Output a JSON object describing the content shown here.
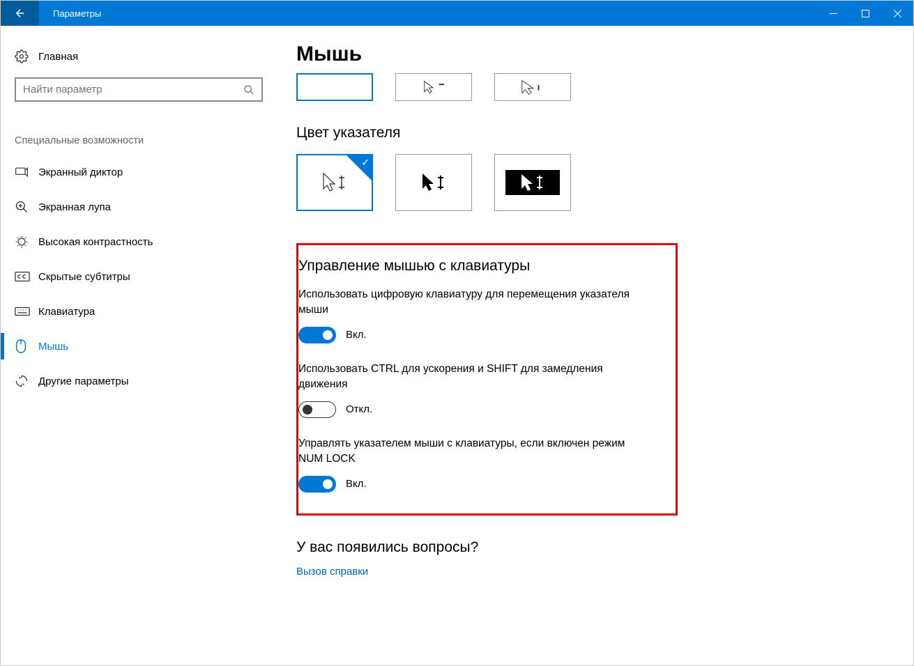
{
  "titlebar": {
    "title": "Параметры"
  },
  "sidebar": {
    "home": "Главная",
    "search_placeholder": "Найти параметр",
    "section": "Специальные возможности",
    "items": [
      {
        "label": "Экранный диктор"
      },
      {
        "label": "Экранная лупа"
      },
      {
        "label": "Высокая контрастность"
      },
      {
        "label": "Скрытые субтитры"
      },
      {
        "label": "Клавиатура"
      },
      {
        "label": "Мышь"
      },
      {
        "label": "Другие параметры"
      }
    ]
  },
  "main": {
    "title": "Мышь",
    "pointer_color_heading": "Цвет указателя",
    "keyboard_control": {
      "heading": "Управление мышью с клавиатуры",
      "numpad_label": "Использовать цифровую клавиатуру для перемещения указателя мыши",
      "numpad_state": "Вкл.",
      "ctrlshift_label": "Использовать CTRL для ускорения и SHIFT для замедления движения",
      "ctrlshift_state": "Откл.",
      "numlock_label": "Управлять указателем мыши с клавиатуры, если включен режим NUM LOCK",
      "numlock_state": "Вкл."
    },
    "questions_heading": "У вас появились вопросы?",
    "help_link": "Вызов справки"
  }
}
